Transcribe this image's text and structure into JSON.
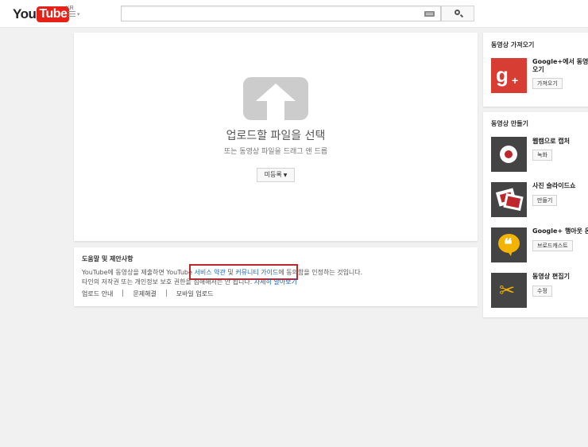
{
  "header": {
    "logo_you": "You",
    "logo_tube": "Tube",
    "logo_region": "KR",
    "search_placeholder": ""
  },
  "upload": {
    "title": "업로드할 파일을 선택",
    "subtitle": "또는 동영상 파일을 드래그 앤 드롭",
    "privacy_label": "미등록"
  },
  "help": {
    "title": "도움말 및 제안사항",
    "line1_prefix": "YouTube에 동영상을 제출하면 YouTube ",
    "terms_link": "서비스 약관",
    "and": " 및 ",
    "guidelines_link": "커뮤니티 가이드",
    "line1_suffix": "에 동의함을 인정하는 것입니다.",
    "line2_prefix": "타인의 저작권 또는 개인정보 보호 권한을 침해해서는 안 됩니다. ",
    "learn_more_link": "자세히 알아보기",
    "links": [
      "업로드 안내",
      "문제해결",
      "모바일 업로드"
    ]
  },
  "sidebar": {
    "import_title": "동영상 가져오기",
    "import_item": {
      "title_line1": "Google+에서 동영상",
      "title_line2": "오기",
      "button": "가져오기",
      "icon": "google-plus-icon",
      "color": "#d73d32"
    },
    "create_title": "동영상 만들기",
    "create_items": [
      {
        "title": "웹캠으로 캡처",
        "button": "녹화",
        "icon": "record-icon"
      },
      {
        "title": "사진 슬라이드쇼",
        "button": "만들기",
        "icon": "photos-icon"
      },
      {
        "title": "Google+ 행아웃 온",
        "button": "브로드캐스트",
        "icon": "hangouts-icon"
      },
      {
        "title": "동영상 편집기",
        "button": "수정",
        "icon": "scissors-icon"
      }
    ]
  }
}
